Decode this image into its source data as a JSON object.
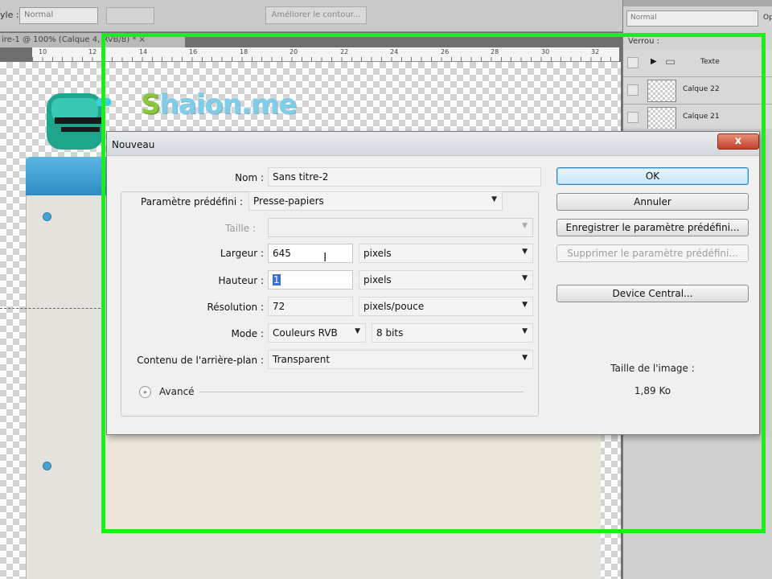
{
  "options_bar": {
    "style_label": "yle :",
    "style_value": "Normal",
    "refine_edge": "Améliorer le contour..."
  },
  "document_tab": {
    "title": "ire-1 @ 100% (Calque 4, RVB/8) * ×"
  },
  "ruler_ticks": [
    "10",
    "12",
    "14",
    "16",
    "18",
    "20",
    "22",
    "24",
    "26",
    "28",
    "30",
    "32"
  ],
  "layers_panel": {
    "blend_mode": "Normal",
    "opacity_label": "Op",
    "lock_label": "Verrou :",
    "layers": [
      {
        "name": "Texte",
        "type": "folder"
      },
      {
        "name": "Calque 22",
        "type": "layer"
      },
      {
        "name": "Calque 21",
        "type": "layer"
      }
    ]
  },
  "logo": {
    "s": "S",
    "rest": "haion.me"
  },
  "dialog": {
    "title": "Nouveau",
    "close": "x",
    "name_label": "Nom :",
    "name_value": "Sans titre-2",
    "preset_label": "Paramètre prédéfini :",
    "preset_value": "Presse-papiers",
    "size_label": "Taille :",
    "size_value": "",
    "width_label": "Largeur :",
    "width_value": "645",
    "width_unit": "pixels",
    "height_label": "Hauteur :",
    "height_value": "1",
    "height_unit": "pixels",
    "resolution_label": "Résolution :",
    "resolution_value": "72",
    "resolution_unit": "pixels/pouce",
    "mode_label": "Mode :",
    "mode_value": "Couleurs RVB",
    "bits_value": "8 bits",
    "background_label": "Contenu de l'arrière-plan :",
    "background_value": "Transparent",
    "advanced_label": "Avancé",
    "buttons": {
      "ok": "OK",
      "cancel": "Annuler",
      "save_preset": "Enregistrer le paramètre prédéfini...",
      "delete_preset": "Supprimer le paramètre prédéfini...",
      "device_central": "Device Central..."
    },
    "image_size_label": "Taille de l'image :",
    "image_size_value": "1,89 Ko"
  }
}
